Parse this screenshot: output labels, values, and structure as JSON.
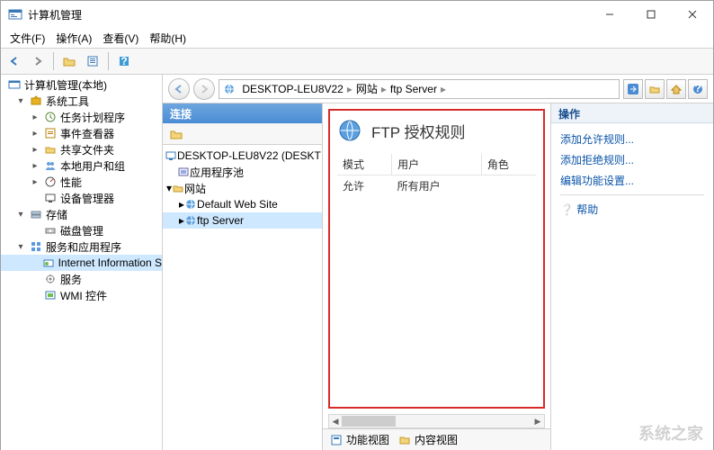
{
  "window": {
    "title": "计算机管理"
  },
  "menus": {
    "file": "文件(F)",
    "action": "操作(A)",
    "view": "查看(V)",
    "help": "帮助(H)"
  },
  "tree": {
    "root": "计算机管理(本地)",
    "systools": "系统工具",
    "tasksched": "任务计划程序",
    "eventvwr": "事件查看器",
    "shared": "共享文件夹",
    "localusers": "本地用户和组",
    "perf": "性能",
    "devmgr": "设备管理器",
    "storage": "存储",
    "diskmgmt": "磁盘管理",
    "apps": "服务和应用程序",
    "iis": "Internet Information S",
    "services": "服务",
    "wmi": "WMI 控件"
  },
  "breadcrumb": {
    "host": "DESKTOP-LEU8V22",
    "sites": "网站",
    "site": "ftp Server"
  },
  "conn": {
    "header": "连接",
    "host": "DESKTOP-LEU8V22 (DESKT",
    "apppools": "应用程序池",
    "sites": "网站",
    "dws": "Default Web Site",
    "ftp": "ftp Server"
  },
  "center": {
    "title": "FTP 授权规则",
    "colMode": "模式",
    "colUser": "用户",
    "colRole": "角色",
    "rowMode": "允许",
    "rowUser": "所有用户",
    "tabFeature": "功能视图",
    "tabContent": "内容视图"
  },
  "actions": {
    "header": "操作",
    "addAllow": "添加允许规则...",
    "addDeny": "添加拒绝规则...",
    "editFeat": "编辑功能设置...",
    "help": "帮助"
  },
  "watermark": "系统之家"
}
